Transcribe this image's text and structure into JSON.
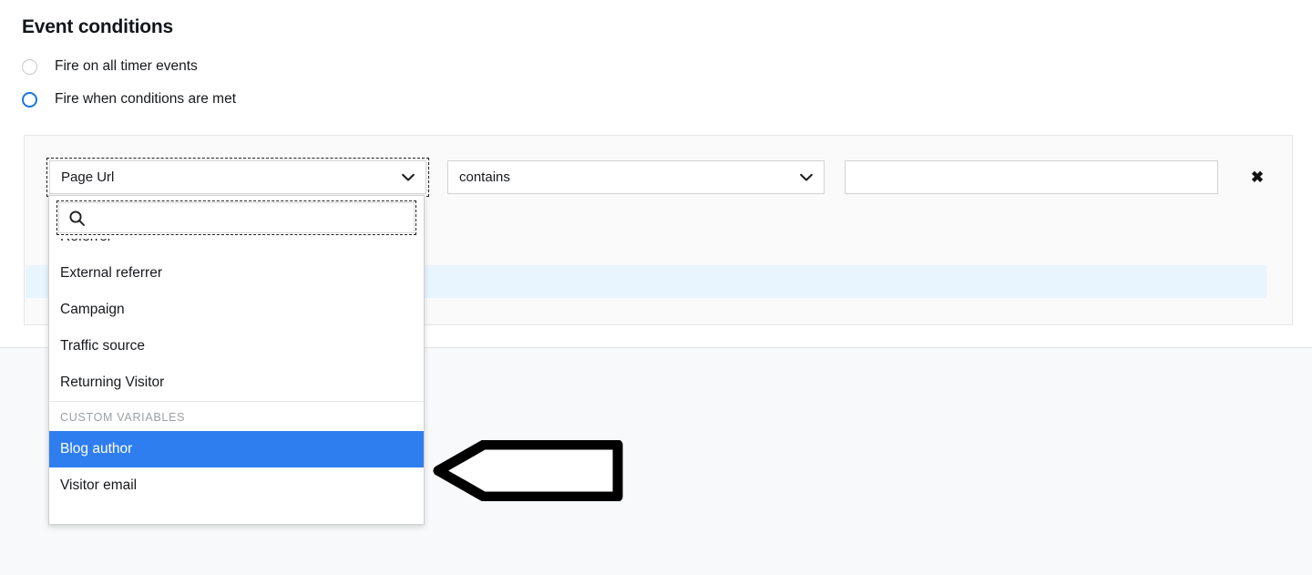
{
  "page": {
    "title": "Event conditions"
  },
  "trigger_options": [
    {
      "label": "Fire on all timer events",
      "selected": false
    },
    {
      "label": "Fire when conditions are met",
      "selected": true
    }
  ],
  "condition_row": {
    "field_select": {
      "value": "Page Url",
      "caret_icon": "chevron-down-icon",
      "focused": true
    },
    "operator_select": {
      "value": "contains",
      "caret_icon": "chevron-down-icon"
    },
    "value_input": {
      "value": "",
      "placeholder": ""
    },
    "remove_button": {
      "label": "✖",
      "icon": "close-icon"
    }
  },
  "dropdown": {
    "search": {
      "value": "",
      "placeholder": "",
      "icon": "search-icon"
    },
    "items": [
      {
        "label": "Referrer",
        "selected": false,
        "clipped": true
      },
      {
        "label": "External referrer",
        "selected": false
      },
      {
        "label": "Campaign",
        "selected": false
      },
      {
        "label": "Traffic source",
        "selected": false
      },
      {
        "label": "Returning Visitor",
        "selected": false
      }
    ],
    "group_header": "CUSTOM VARIABLES",
    "custom_variables": [
      {
        "label": "Blog author",
        "selected": true
      },
      {
        "label": "Visitor email",
        "selected": false
      }
    ]
  },
  "annotation": {
    "shape": "left-arrow-outline"
  },
  "colors": {
    "accent_blue": "#1a73e8",
    "selection_blue": "#2f7ef0",
    "highlight_band": "#e8f4fe",
    "panel_bg": "#fafafa",
    "lower_bg": "#f8f9fa"
  }
}
